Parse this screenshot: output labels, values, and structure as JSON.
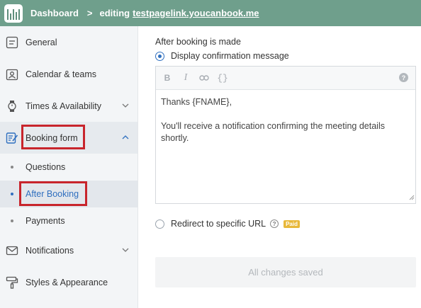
{
  "header": {
    "dashboard": "Dashboard",
    "separator": ">",
    "editing_prefix": "editing",
    "page_link": "testpagelink.youcanbook.me"
  },
  "sidebar": {
    "items": [
      {
        "label": "General",
        "icon": "document-icon"
      },
      {
        "label": "Calendar & teams",
        "icon": "calendar-person-icon"
      },
      {
        "label": "Times & Availability",
        "icon": "watch-icon"
      },
      {
        "label": "Booking form",
        "icon": "form-edit-icon"
      },
      {
        "label": "Notifications",
        "icon": "envelope-icon"
      },
      {
        "label": "Styles & Appearance",
        "icon": "paint-roller-icon"
      }
    ],
    "subitems": [
      {
        "label": "Questions"
      },
      {
        "label": "After Booking"
      },
      {
        "label": "Payments"
      }
    ]
  },
  "main": {
    "section_title": "After booking is made",
    "option_message": "Display confirmation message",
    "option_redirect": "Redirect to specific URL",
    "paid_badge": "Paid",
    "editor_lines": [
      "Thanks {FNAME},",
      "You'll receive a notification confirming the meeting details shortly."
    ],
    "toolbar": {
      "bold": "B",
      "italic": "I",
      "braces": "{}",
      "help": "?"
    },
    "saved_button": "All changes saved"
  },
  "colors": {
    "header_bg": "#6f9f8c",
    "accent": "#2f6fbf",
    "highlight": "#c8252c",
    "paid": "#e8b83a"
  }
}
